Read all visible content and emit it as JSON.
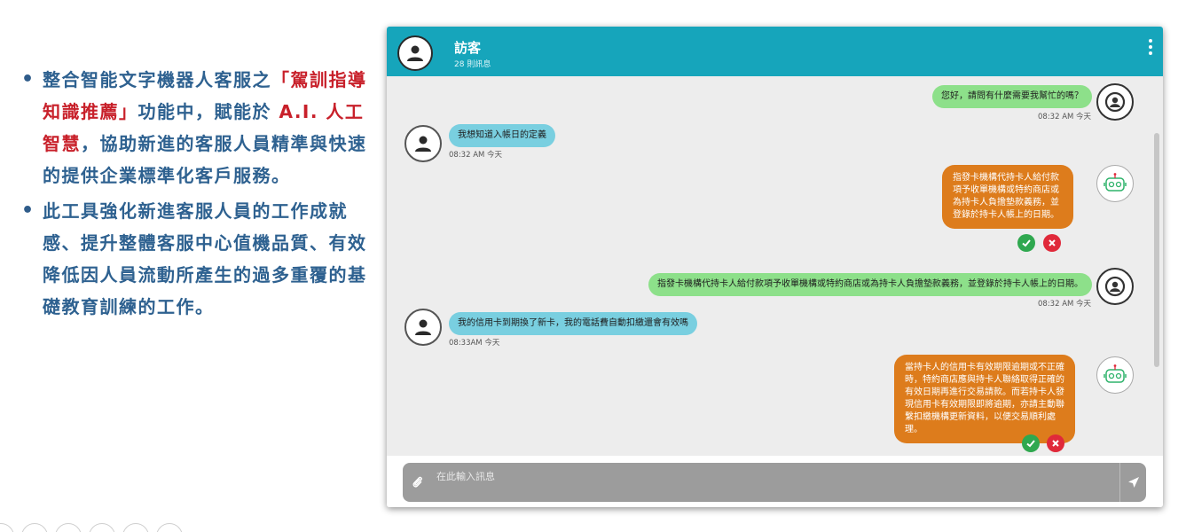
{
  "bullets": [
    {
      "segments": [
        {
          "text": "整合智能文字機器人客服之",
          "hl": false
        },
        {
          "text": "「駕訓指導知識推薦」",
          "hl": true
        },
        {
          "text": "功能中，賦能於 ",
          "hl": false
        },
        {
          "text": "A.I. 人工智慧",
          "hl": true
        },
        {
          "text": "，協助新進的客服人員精準與快速的提供企業標準化客戶服務。",
          "hl": false
        }
      ]
    },
    {
      "segments": [
        {
          "text": "此工具強化新進客服人員的工作成就感、提升整體客服中心值機品質、有效降低因人員流動所產生的過多重覆的基礎教育訓練的工作。",
          "hl": false
        }
      ]
    }
  ],
  "chat": {
    "header": {
      "name": "訪客",
      "count": "28 則訊息"
    },
    "messages": {
      "m1": {
        "text": "您好，請問有什麼需要我幫忙的嗎？",
        "time": "08:32 AM 今天"
      },
      "m2": {
        "text": "我想知道入帳日的定義",
        "time": "08:32 AM 今天"
      },
      "m3": {
        "text": "指發卡機構代持卡人給付款項予收單機構或特約商店或為持卡人負擔墊款義務，並登錄於持卡人帳上的日期。"
      },
      "m4": {
        "text": "指發卡機構代持卡人給付款項予收單機構或特約商店或為持卡人負擔墊款義務，並登錄於持卡人帳上的日期。",
        "time": "08:32 AM 今天"
      },
      "m5": {
        "text": "我的信用卡到期換了新卡，我的電話費自動扣繳還會有效嗎",
        "time": "08:33AM 今天"
      },
      "m6": {
        "text": "當持卡人的信用卡有效期限逾期或不正確時，特約商店應與持卡人聯絡取得正確的有效日期再進行交易請款。而若持卡人發現信用卡有效期限即將逾期，亦請主動聯繫扣繳機構更新資料，以便交易順利處理。"
      }
    },
    "input": {
      "placeholder": "在此輸入訊息"
    }
  },
  "colors": {
    "header": "#16a5bb",
    "bot_bubble": "#dd7c1c",
    "agent_bubble": "#8de08a",
    "visitor_bubble": "#79cfe0",
    "accept": "#2fa84f",
    "reject": "#e0293a",
    "bullet_text": "#2e6190",
    "highlight": "#c8202a"
  },
  "icons": [
    "person-icon",
    "robot-icon",
    "check-icon",
    "close-icon",
    "paperclip-icon",
    "send-icon",
    "kebab-menu-icon"
  ]
}
